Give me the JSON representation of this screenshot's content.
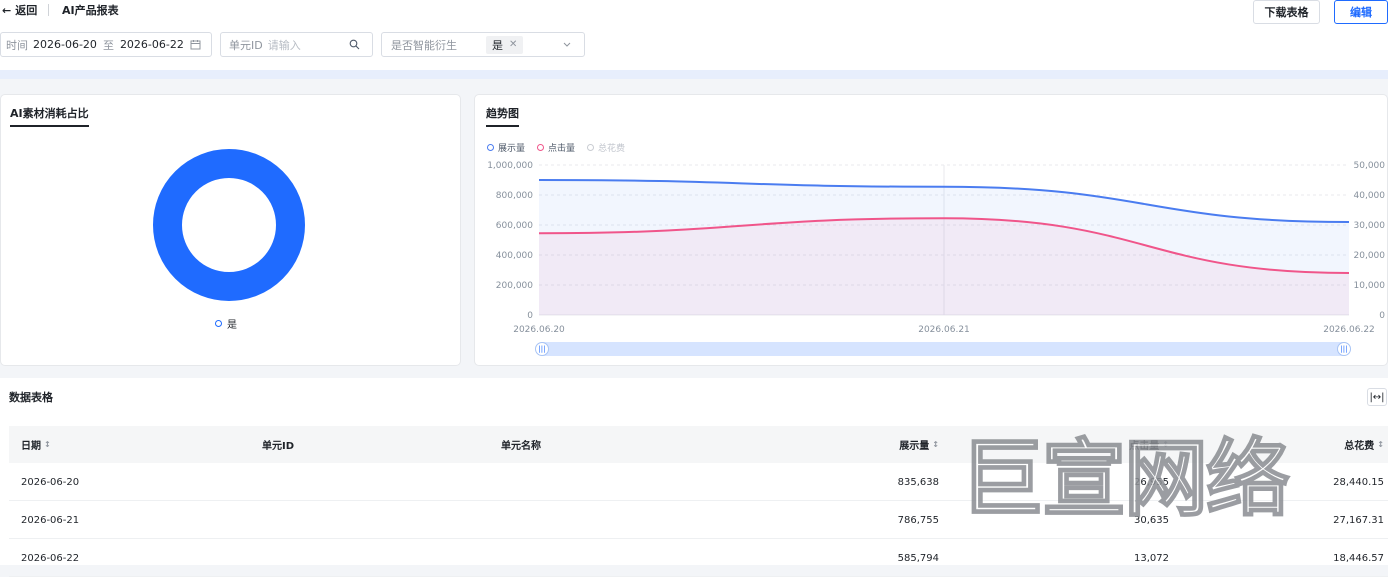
{
  "header": {
    "back_label": "返回",
    "title": "AI产品报表",
    "download_label": "下载表格",
    "edit_label": "编辑"
  },
  "filters": {
    "date_label": "时间",
    "date_start": "2026-06-20",
    "date_to": "至",
    "date_end": "2026-06-22",
    "unit_label": "单元ID",
    "unit_placeholder": "请输入",
    "ai_label": "是否智能衍生",
    "ai_value": "是"
  },
  "pie_card": {
    "title": "AI素材消耗占比",
    "legend": "是",
    "slices": [
      {
        "name": "是",
        "value": 100
      }
    ],
    "color": "#1f6bff"
  },
  "trend_card": {
    "title": "趋势图",
    "legend": [
      "展示量",
      "点击量",
      "总花费"
    ]
  },
  "chart_data": {
    "type": "line",
    "x": [
      "2026.06.20",
      "2026.06.21",
      "2026.06.22"
    ],
    "series": [
      {
        "name": "展示量",
        "values": [
          900000,
          855000,
          620000
        ],
        "axis": "left",
        "color": "#4a7cf0"
      },
      {
        "name": "点击量",
        "values": [
          545000,
          645000,
          280000
        ],
        "axis": "left",
        "color": "#f0558a"
      },
      {
        "name": "总花费",
        "values": [],
        "axis": "right",
        "color": "#c9ccd2"
      }
    ],
    "y_left_ticks": [
      "1,000,000",
      "800,000",
      "600,000",
      "400,000",
      "200,000",
      "0"
    ],
    "y_right_ticks": [
      "50,000",
      "40,000",
      "30,000",
      "20,000",
      "10,000",
      "0"
    ],
    "ylim_left": [
      0,
      1000000
    ],
    "ylim_right": [
      0,
      50000
    ],
    "grid": true,
    "legend_position": "top-left"
  },
  "table": {
    "title": "数据表格",
    "headers": [
      "日期",
      "单元ID",
      "单元名称",
      "展示量",
      "点击量",
      "总花费"
    ],
    "rows": [
      {
        "date": "2026-06-20",
        "unit_id": "",
        "unit_name": "",
        "impressions": "835,638",
        "clicks": "26,955",
        "cost": "28,440.15"
      },
      {
        "date": "2026-06-21",
        "unit_id": "",
        "unit_name": "",
        "impressions": "786,755",
        "clicks": "30,635",
        "cost": "27,167.31"
      },
      {
        "date": "2026-06-22",
        "unit_id": "",
        "unit_name": "",
        "impressions": "585,794",
        "clicks": "13,072",
        "cost": "18,446.57"
      }
    ]
  },
  "watermark": "巨宣网络"
}
